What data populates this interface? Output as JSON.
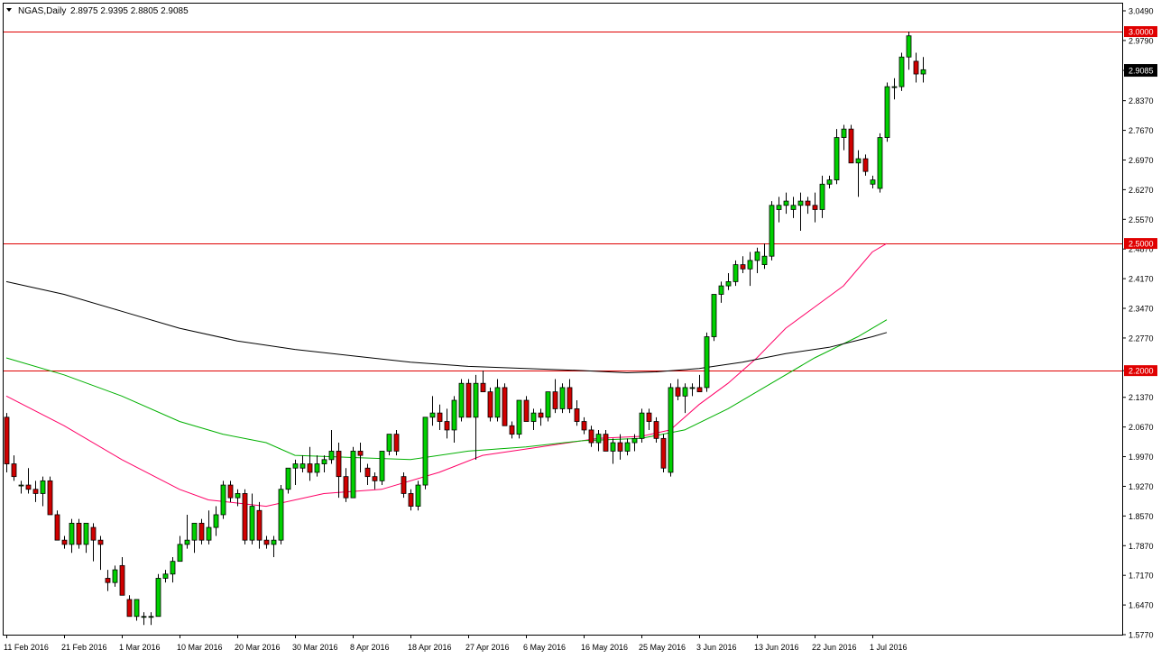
{
  "header": {
    "symbol_label": "NGAS,Daily",
    "ohlc": "2.8975 2.9395 2.8805 2.9085"
  },
  "chart_data": {
    "type": "candlestick",
    "symbol": "NGAS",
    "timeframe": "Daily",
    "ylim": [
      1.577,
      3.049
    ],
    "y_ticks": [
      "3.0490",
      "2.9790",
      "2.9085",
      "2.8370",
      "2.7670",
      "2.6970",
      "2.6270",
      "2.5570",
      "2.4870",
      "2.4170",
      "2.3470",
      "2.2770",
      "2.2000",
      "2.1370",
      "2.0670",
      "1.9970",
      "1.9270",
      "1.8570",
      "1.7870",
      "1.7170",
      "1.6470",
      "1.5770"
    ],
    "x_tick_labels": [
      {
        "label": "11 Feb 2016",
        "bar": 0
      },
      {
        "label": "21 Feb 2016",
        "bar": 8
      },
      {
        "label": "1 Mar 2016",
        "bar": 16
      },
      {
        "label": "10 Mar 2016",
        "bar": 24
      },
      {
        "label": "20 Mar 2016",
        "bar": 32
      },
      {
        "label": "30 Mar 2016",
        "bar": 40
      },
      {
        "label": "8 Apr 2016",
        "bar": 48
      },
      {
        "label": "18 Apr 2016",
        "bar": 56
      },
      {
        "label": "27 Apr 2016",
        "bar": 64
      },
      {
        "label": "6 May 2016",
        "bar": 72
      },
      {
        "label": "16 May 2016",
        "bar": 80
      },
      {
        "label": "25 May 2016",
        "bar": 88
      },
      {
        "label": "3 Jun 2016",
        "bar": 96
      },
      {
        "label": "13 Jun 2016",
        "bar": 104
      },
      {
        "label": "22 Jun 2016",
        "bar": 112
      },
      {
        "label": "1 Jul 2016",
        "bar": 120
      }
    ],
    "horizontal_lines": [
      {
        "price": 3.0,
        "label": "3.0000",
        "color": "#e00000"
      },
      {
        "price": 2.5,
        "label": "2.5000",
        "color": "#e00000"
      },
      {
        "price": 2.2,
        "label": "2.2000",
        "color": "#e00000"
      }
    ],
    "current_price": {
      "price": 2.9085,
      "label": "2.9085"
    },
    "colors": {
      "up": "#00d000",
      "down": "#d00000",
      "wick": "#000000",
      "level": "#e00000",
      "ma_pink": "#ff0066",
      "ma_green": "#00b000",
      "ma_black": "#000000"
    },
    "candles": [
      [
        2.09,
        2.1,
        1.96,
        1.98
      ],
      [
        1.98,
        2.0,
        1.94,
        1.95
      ],
      [
        1.93,
        1.94,
        1.91,
        1.93
      ],
      [
        1.93,
        1.97,
        1.91,
        1.92
      ],
      [
        1.92,
        1.94,
        1.89,
        1.91
      ],
      [
        1.91,
        1.95,
        1.88,
        1.94
      ],
      [
        1.94,
        1.95,
        1.86,
        1.86
      ],
      [
        1.86,
        1.87,
        1.8,
        1.8
      ],
      [
        1.8,
        1.81,
        1.78,
        1.79
      ],
      [
        1.79,
        1.85,
        1.77,
        1.84
      ],
      [
        1.84,
        1.85,
        1.78,
        1.79
      ],
      [
        1.79,
        1.84,
        1.77,
        1.84
      ],
      [
        1.83,
        1.84,
        1.75,
        1.8
      ],
      [
        1.8,
        1.81,
        1.73,
        1.79
      ],
      [
        1.71,
        1.73,
        1.68,
        1.7
      ],
      [
        1.7,
        1.74,
        1.69,
        1.73
      ],
      [
        1.74,
        1.76,
        1.67,
        1.67
      ],
      [
        1.66,
        1.67,
        1.62,
        1.62
      ],
      [
        1.62,
        1.66,
        1.61,
        1.66
      ],
      [
        1.62,
        1.63,
        1.6,
        1.62
      ],
      [
        1.62,
        1.63,
        1.6,
        1.62
      ],
      [
        1.62,
        1.72,
        1.62,
        1.71
      ],
      [
        1.71,
        1.73,
        1.7,
        1.72
      ],
      [
        1.72,
        1.76,
        1.7,
        1.75
      ],
      [
        1.75,
        1.81,
        1.75,
        1.79
      ],
      [
        1.79,
        1.86,
        1.78,
        1.8
      ],
      [
        1.8,
        1.84,
        1.77,
        1.84
      ],
      [
        1.84,
        1.85,
        1.79,
        1.8
      ],
      [
        1.8,
        1.87,
        1.79,
        1.83
      ],
      [
        1.83,
        1.88,
        1.81,
        1.86
      ],
      [
        1.86,
        1.94,
        1.85,
        1.93
      ],
      [
        1.93,
        1.94,
        1.89,
        1.9
      ],
      [
        1.9,
        1.92,
        1.88,
        1.91
      ],
      [
        1.91,
        1.92,
        1.79,
        1.8
      ],
      [
        1.8,
        1.91,
        1.79,
        1.88
      ],
      [
        1.87,
        1.89,
        1.78,
        1.8
      ],
      [
        1.8,
        1.81,
        1.78,
        1.79
      ],
      [
        1.79,
        1.81,
        1.76,
        1.8
      ],
      [
        1.8,
        1.93,
        1.79,
        1.92
      ],
      [
        1.92,
        1.97,
        1.91,
        1.97
      ],
      [
        1.97,
        1.99,
        1.93,
        1.98
      ],
      [
        1.97,
        2.0,
        1.96,
        1.98
      ],
      [
        1.98,
        2.02,
        1.94,
        1.96
      ],
      [
        1.96,
        2.0,
        1.95,
        1.98
      ],
      [
        1.98,
        2.0,
        1.96,
        1.99
      ],
      [
        1.99,
        2.06,
        1.98,
        2.01
      ],
      [
        2.01,
        2.03,
        1.9,
        1.95
      ],
      [
        1.95,
        1.97,
        1.89,
        1.9
      ],
      [
        1.9,
        2.02,
        1.9,
        2.01
      ],
      [
        2.01,
        2.03,
        1.96,
        2.0
      ],
      [
        1.97,
        1.98,
        1.93,
        1.95
      ],
      [
        1.95,
        1.96,
        1.92,
        1.94
      ],
      [
        1.94,
        2.01,
        1.93,
        2.01
      ],
      [
        2.01,
        2.05,
        2.0,
        2.05
      ],
      [
        2.05,
        2.06,
        2.0,
        2.01
      ],
      [
        1.95,
        1.96,
        1.9,
        1.91
      ],
      [
        1.91,
        1.92,
        1.87,
        1.88
      ],
      [
        1.88,
        1.94,
        1.87,
        1.93
      ],
      [
        1.93,
        2.09,
        1.92,
        2.09
      ],
      [
        2.09,
        2.14,
        2.07,
        2.1
      ],
      [
        2.1,
        2.12,
        2.06,
        2.08
      ],
      [
        2.08,
        2.11,
        2.04,
        2.06
      ],
      [
        2.06,
        2.14,
        2.03,
        2.13
      ],
      [
        2.09,
        2.18,
        2.08,
        2.17
      ],
      [
        2.17,
        2.18,
        2.09,
        2.09
      ],
      [
        2.09,
        2.19,
        1.99,
        2.17
      ],
      [
        2.17,
        2.2,
        2.16,
        2.15
      ],
      [
        2.15,
        2.16,
        2.08,
        2.09
      ],
      [
        2.09,
        2.18,
        2.08,
        2.16
      ],
      [
        2.16,
        2.17,
        2.07,
        2.07
      ],
      [
        2.07,
        2.08,
        2.04,
        2.05
      ],
      [
        2.05,
        2.13,
        2.04,
        2.13
      ],
      [
        2.13,
        2.14,
        2.08,
        2.08
      ],
      [
        2.08,
        2.11,
        2.06,
        2.1
      ],
      [
        2.1,
        2.11,
        2.07,
        2.09
      ],
      [
        2.09,
        2.15,
        2.08,
        2.15
      ],
      [
        2.15,
        2.18,
        2.1,
        2.11
      ],
      [
        2.11,
        2.17,
        2.1,
        2.16
      ],
      [
        2.16,
        2.18,
        2.1,
        2.11
      ],
      [
        2.11,
        2.13,
        2.07,
        2.08
      ],
      [
        2.08,
        2.09,
        2.05,
        2.06
      ],
      [
        2.06,
        2.07,
        2.02,
        2.03
      ],
      [
        2.03,
        2.06,
        2.01,
        2.05
      ],
      [
        2.05,
        2.06,
        2.01,
        2.01
      ],
      [
        2.01,
        2.04,
        1.98,
        2.03
      ],
      [
        2.03,
        2.05,
        1.99,
        2.01
      ],
      [
        2.01,
        2.04,
        2.0,
        2.03
      ],
      [
        2.03,
        2.05,
        2.01,
        2.04
      ],
      [
        2.04,
        2.11,
        2.03,
        2.1
      ],
      [
        2.1,
        2.11,
        2.06,
        2.08
      ],
      [
        2.08,
        2.09,
        2.03,
        2.04
      ],
      [
        2.04,
        2.05,
        1.96,
        1.97
      ],
      [
        1.96,
        2.17,
        1.95,
        2.16
      ],
      [
        2.16,
        2.18,
        2.13,
        2.14
      ],
      [
        2.14,
        2.17,
        2.1,
        2.16
      ],
      [
        2.16,
        2.17,
        2.14,
        2.16
      ],
      [
        2.16,
        2.19,
        2.15,
        2.15
      ],
      [
        2.16,
        2.29,
        2.15,
        2.28
      ],
      [
        2.28,
        2.38,
        2.27,
        2.38
      ],
      [
        2.38,
        2.41,
        2.36,
        2.4
      ],
      [
        2.4,
        2.43,
        2.39,
        2.41
      ],
      [
        2.41,
        2.46,
        2.4,
        2.45
      ],
      [
        2.45,
        2.47,
        2.43,
        2.44
      ],
      [
        2.44,
        2.48,
        2.4,
        2.46
      ],
      [
        2.46,
        2.49,
        2.43,
        2.48
      ],
      [
        2.45,
        2.5,
        2.44,
        2.47
      ],
      [
        2.47,
        2.6,
        2.46,
        2.59
      ],
      [
        2.58,
        2.61,
        2.55,
        2.59
      ],
      [
        2.59,
        2.62,
        2.57,
        2.6
      ],
      [
        2.58,
        2.61,
        2.56,
        2.59
      ],
      [
        2.59,
        2.62,
        2.53,
        2.6
      ],
      [
        2.6,
        2.61,
        2.57,
        2.59
      ],
      [
        2.59,
        2.62,
        2.55,
        2.58
      ],
      [
        2.58,
        2.66,
        2.56,
        2.64
      ],
      [
        2.64,
        2.66,
        2.63,
        2.65
      ],
      [
        2.65,
        2.77,
        2.64,
        2.75
      ],
      [
        2.75,
        2.78,
        2.72,
        2.77
      ],
      [
        2.77,
        2.78,
        2.69,
        2.69
      ],
      [
        2.69,
        2.72,
        2.61,
        2.7
      ],
      [
        2.7,
        2.71,
        2.66,
        2.67
      ],
      [
        2.64,
        2.66,
        2.63,
        2.65
      ],
      [
        2.63,
        2.76,
        2.62,
        2.75
      ],
      [
        2.75,
        2.88,
        2.74,
        2.87
      ],
      [
        2.87,
        2.89,
        2.84,
        2.87
      ],
      [
        2.87,
        2.95,
        2.86,
        2.94
      ],
      [
        2.94,
        3.0,
        2.91,
        2.99
      ],
      [
        2.93,
        2.95,
        2.88,
        2.9
      ],
      [
        2.9,
        2.94,
        2.88,
        2.91
      ]
    ],
    "moving_averages": [
      {
        "color": "#ff0066",
        "points": [
          [
            0,
            2.14
          ],
          [
            8,
            2.07
          ],
          [
            16,
            1.99
          ],
          [
            24,
            1.92
          ],
          [
            28,
            1.895
          ],
          [
            36,
            1.88
          ],
          [
            44,
            1.91
          ],
          [
            52,
            1.92
          ],
          [
            60,
            1.96
          ],
          [
            66,
            2.0
          ],
          [
            74,
            2.02
          ],
          [
            82,
            2.04
          ],
          [
            88,
            2.045
          ],
          [
            92,
            2.06
          ],
          [
            96,
            2.12
          ],
          [
            100,
            2.17
          ],
          [
            104,
            2.23
          ],
          [
            108,
            2.3
          ],
          [
            112,
            2.35
          ],
          [
            116,
            2.4
          ],
          [
            120,
            2.48
          ],
          [
            122,
            2.5
          ]
        ]
      },
      {
        "color": "#00b000",
        "points": [
          [
            0,
            2.23
          ],
          [
            8,
            2.19
          ],
          [
            16,
            2.14
          ],
          [
            24,
            2.08
          ],
          [
            30,
            2.05
          ],
          [
            36,
            2.03
          ],
          [
            40,
            2.0
          ],
          [
            48,
            1.995
          ],
          [
            56,
            1.99
          ],
          [
            64,
            2.01
          ],
          [
            72,
            2.02
          ],
          [
            80,
            2.035
          ],
          [
            88,
            2.04
          ],
          [
            94,
            2.06
          ],
          [
            100,
            2.11
          ],
          [
            106,
            2.17
          ],
          [
            112,
            2.23
          ],
          [
            118,
            2.28
          ],
          [
            122,
            2.32
          ]
        ]
      },
      {
        "color": "#000000",
        "points": [
          [
            0,
            2.41
          ],
          [
            8,
            2.38
          ],
          [
            16,
            2.34
          ],
          [
            24,
            2.3
          ],
          [
            32,
            2.27
          ],
          [
            40,
            2.25
          ],
          [
            48,
            2.235
          ],
          [
            56,
            2.22
          ],
          [
            64,
            2.21
          ],
          [
            72,
            2.205
          ],
          [
            80,
            2.2
          ],
          [
            86,
            2.195
          ],
          [
            90,
            2.197
          ],
          [
            96,
            2.205
          ],
          [
            102,
            2.22
          ],
          [
            108,
            2.24
          ],
          [
            114,
            2.255
          ],
          [
            120,
            2.28
          ],
          [
            122,
            2.29
          ]
        ]
      }
    ]
  }
}
